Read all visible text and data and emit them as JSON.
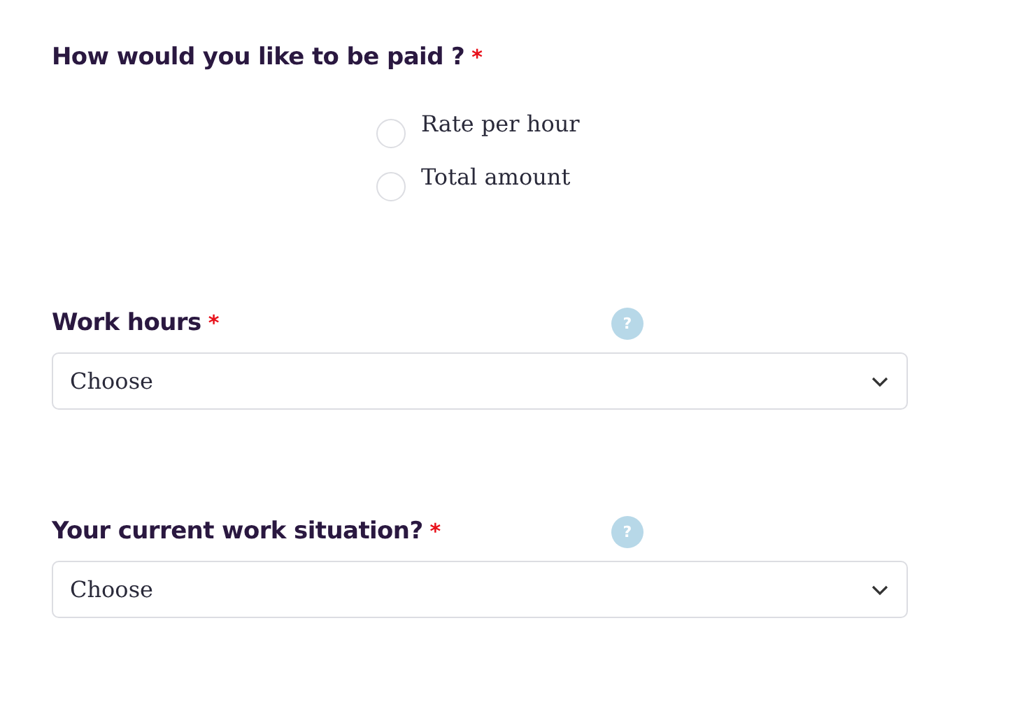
{
  "questions": [
    {
      "kind": "radio",
      "label": "How would you like to be paid ?",
      "required_mark": "*",
      "options": [
        {
          "label": "Rate per hour",
          "selected": false
        },
        {
          "label": "Total amount",
          "selected": false
        }
      ]
    },
    {
      "kind": "select",
      "label": "Work hours",
      "required_mark": "*",
      "help": "?",
      "value": "Choose"
    },
    {
      "kind": "select",
      "label": "Your current work situation?",
      "required_mark": "*",
      "help": "?",
      "value": "Choose"
    }
  ]
}
